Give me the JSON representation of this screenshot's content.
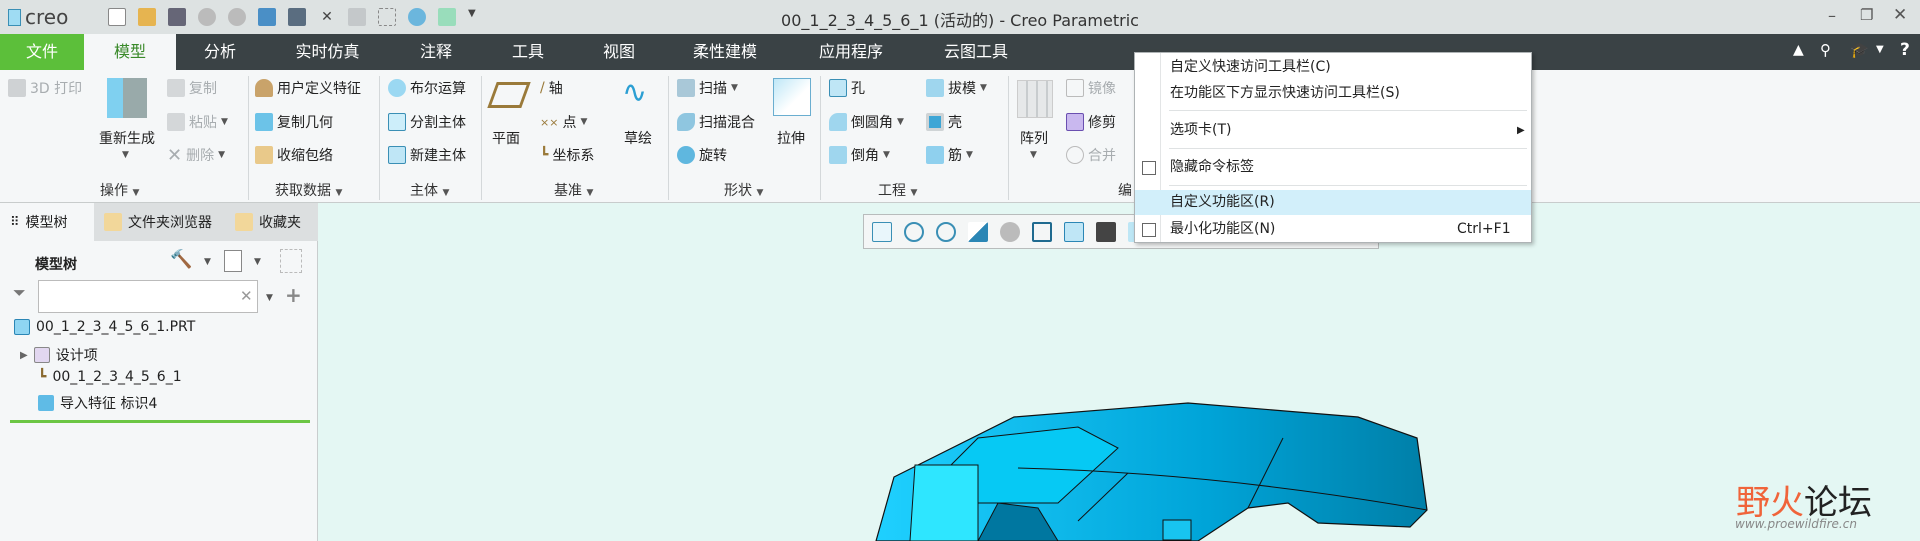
{
  "app": {
    "logo": "creo",
    "title": "00_1_2_3_4_5_6_1 (活动的) - Creo Parametric"
  },
  "quick_access": [
    "new-icon",
    "open-icon",
    "save-icon",
    "undo-icon",
    "redo-icon",
    "regenerate-icon",
    "windows-icon",
    "close-window-icon",
    "replace-icon",
    "select-icon",
    "revolve-icon",
    "settings-icon"
  ],
  "tabs": [
    {
      "label": "文件"
    },
    {
      "label": "模型"
    },
    {
      "label": "分析"
    },
    {
      "label": "实时仿真"
    },
    {
      "label": "注释"
    },
    {
      "label": "工具"
    },
    {
      "label": "视图"
    },
    {
      "label": "柔性建模"
    },
    {
      "label": "应用程序"
    },
    {
      "label": "云图工具"
    }
  ],
  "ribbon": {
    "ops": {
      "print3d": "3D 打印",
      "regenerate": "重新生成",
      "copy": "复制",
      "paste": "粘贴",
      "delete": "删除",
      "label": "操作"
    },
    "getdata": {
      "udf": "用户定义特征",
      "copygeom": "复制几何",
      "shrinkwrap": "收缩包络",
      "label": "获取数据"
    },
    "body": {
      "boolean": "布尔运算",
      "split": "分割主体",
      "newbody": "新建主体",
      "label": "主体"
    },
    "datum": {
      "plane": "平面",
      "axis": "轴",
      "point": "点",
      "csys": "坐标系",
      "sketch": "草绘",
      "label": "基准"
    },
    "shapes": {
      "sweep": "扫描",
      "sweepblend": "扫描混合",
      "revolve": "旋转",
      "extrude": "拉伸",
      "label": "形状"
    },
    "eng": {
      "hole": "孔",
      "round": "倒圆角",
      "chamfer": "倒角",
      "draft": "拔模",
      "shell": "壳",
      "rib": "筋",
      "label": "工程"
    },
    "edit": {
      "pattern": "阵列",
      "mirror": "镜像",
      "trim": "修剪",
      "merge": "合并",
      "label": "编"
    }
  },
  "context_menu": {
    "items": [
      {
        "label": "自定义快速访问工具栏(C)"
      },
      {
        "label": "在功能区下方显示快速访问工具栏(S)"
      },
      {
        "label": "选项卡(T)"
      },
      {
        "label": "隐藏命令标签",
        "checked": false
      },
      {
        "label": "自定义功能区(R)",
        "highlighted": true
      },
      {
        "label": "最小化功能区(N)",
        "shortcut": "Ctrl+F1",
        "checked": false
      }
    ]
  },
  "left_panel": {
    "tabs": [
      {
        "label": "模型树"
      },
      {
        "label": "文件夹浏览器"
      },
      {
        "label": "收藏夹"
      }
    ],
    "heading": "模型树",
    "search": {
      "value": "",
      "placeholder": ""
    },
    "tree": [
      {
        "label": "00_1_2_3_4_5_6_1.PRT"
      },
      {
        "label": "设计项"
      },
      {
        "label": "00_1_2_3_4_5_6_1"
      },
      {
        "label": "导入特征 标识4"
      }
    ]
  },
  "watermark": {
    "brand": "野火论坛",
    "url": "www.proewildfire.cn"
  },
  "colors": {
    "file_tab": "#5cbf3a",
    "tabbar": "#3a4245",
    "viewport": "#e4f7f3",
    "model": "#00a6d6",
    "highlight": "#d2effa"
  }
}
